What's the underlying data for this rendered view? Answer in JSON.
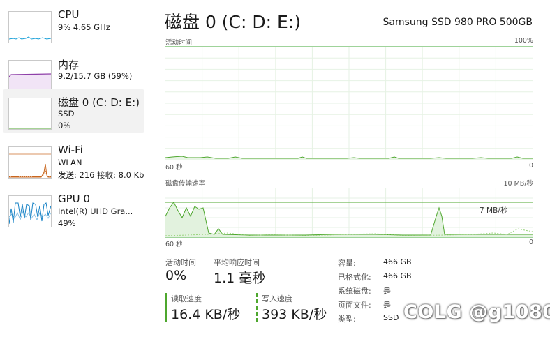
{
  "sidebar": {
    "items": [
      {
        "title": "CPU",
        "line1": "9% 4.65 GHz",
        "line2": ""
      },
      {
        "title": "内存",
        "line1": "9.2/15.7 GB (59%)",
        "line2": ""
      },
      {
        "title": "磁盘 0 (C: D: E:)",
        "line1": "SSD",
        "line2": "0%"
      },
      {
        "title": "Wi-Fi",
        "line1": "WLAN",
        "line2": "发送: 216 接收: 8.0 Kb"
      },
      {
        "title": "GPU 0",
        "line1": "Intel(R) UHD Gra...",
        "line2": "49%"
      }
    ]
  },
  "header": {
    "title": "磁盘 0 (C: D: E:)",
    "device": "Samsung SSD 980 PRO 500GB"
  },
  "graph_activity": {
    "label": "活动时间",
    "max": "100%",
    "time": "60 秒",
    "min": "0"
  },
  "graph_transfer": {
    "label": "磁盘传输速率",
    "max": "10 MB/秒",
    "ref": "7 MB/秒",
    "time": "60 秒",
    "min": "0"
  },
  "stats": {
    "active_time_label": "活动时间",
    "active_time_value": "0%",
    "response_label": "平均响应时间",
    "response_value": "1.1 毫秒",
    "read_label": "读取速度",
    "read_value": "16.4 KB/秒",
    "write_label": "写入速度",
    "write_value": "393 KB/秒"
  },
  "properties": {
    "capacity_key": "容量:",
    "capacity_val": "466 GB",
    "formatted_key": "已格式化:",
    "formatted_val": "466 GB",
    "system_key": "系统磁盘:",
    "system_val": "是",
    "pagefile_key": "页面文件:",
    "pagefile_val": "是",
    "type_key": "类型:",
    "type_val": "SSD"
  },
  "watermark": "COLG @g1080",
  "colors": {
    "accent_green": "#4ea72e",
    "grid": "#e6f2e4",
    "cpu_blue": "#1aa0d8",
    "mem_purple": "#8e3fa8",
    "net_orange": "#c8661e",
    "gpu_blue": "#1883c6"
  }
}
